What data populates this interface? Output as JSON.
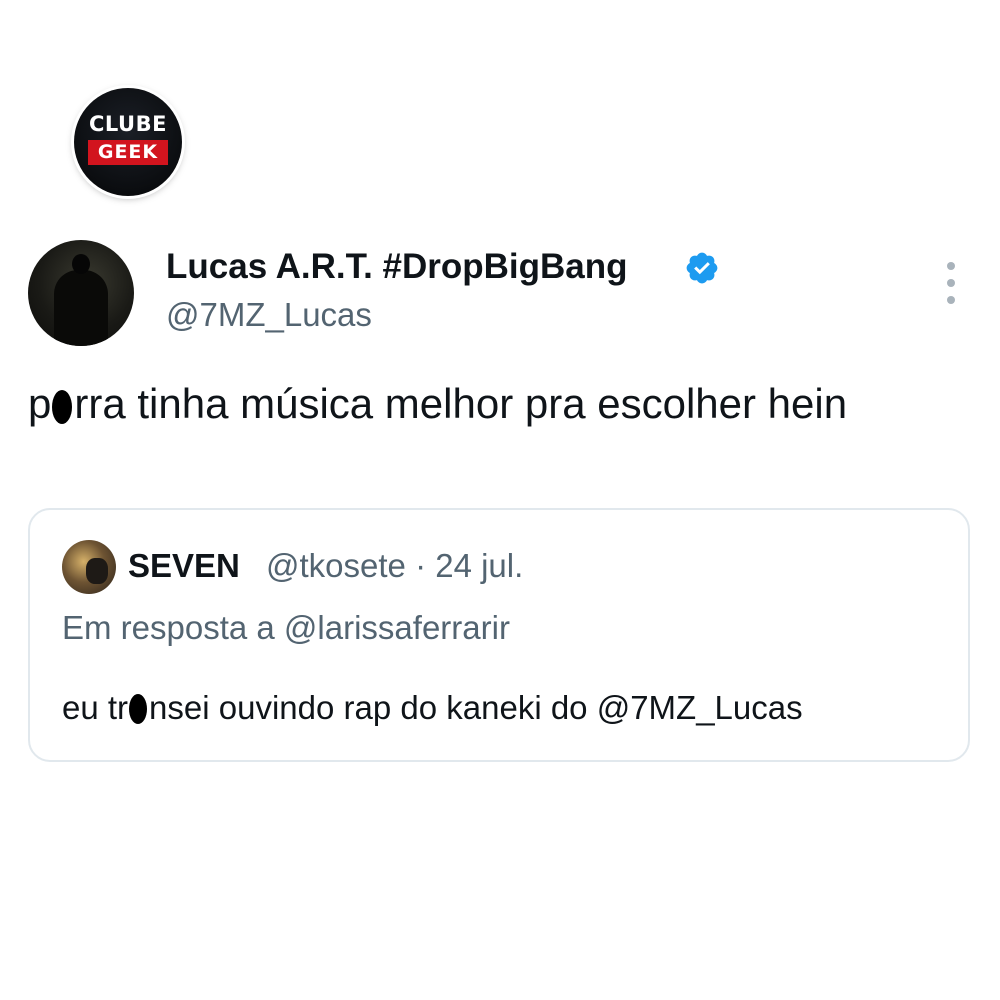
{
  "brand": {
    "top_text": "CLUBE",
    "bottom_text": "GEEK",
    "accent_color": "#d2141e"
  },
  "tweet": {
    "display_name": "Lucas A.R.T. #DropBigBang",
    "handle": "@7MZ_Lucas",
    "verified": true,
    "verified_color": "#1d9bf0",
    "more_icon": "more-vertical-icon",
    "text_before_censor": "p",
    "text_after_censor": "rra tinha música melhor pra escolher hein"
  },
  "quoted_tweet": {
    "display_name": "SEVEN",
    "meta": "@tkosete · 24 jul.",
    "reply_to": "Em resposta a @larissaferrarir",
    "text_before_censor": "eu tr",
    "text_after_censor": "nsei ouvindo rap do kaneki do @7MZ_Lucas"
  }
}
